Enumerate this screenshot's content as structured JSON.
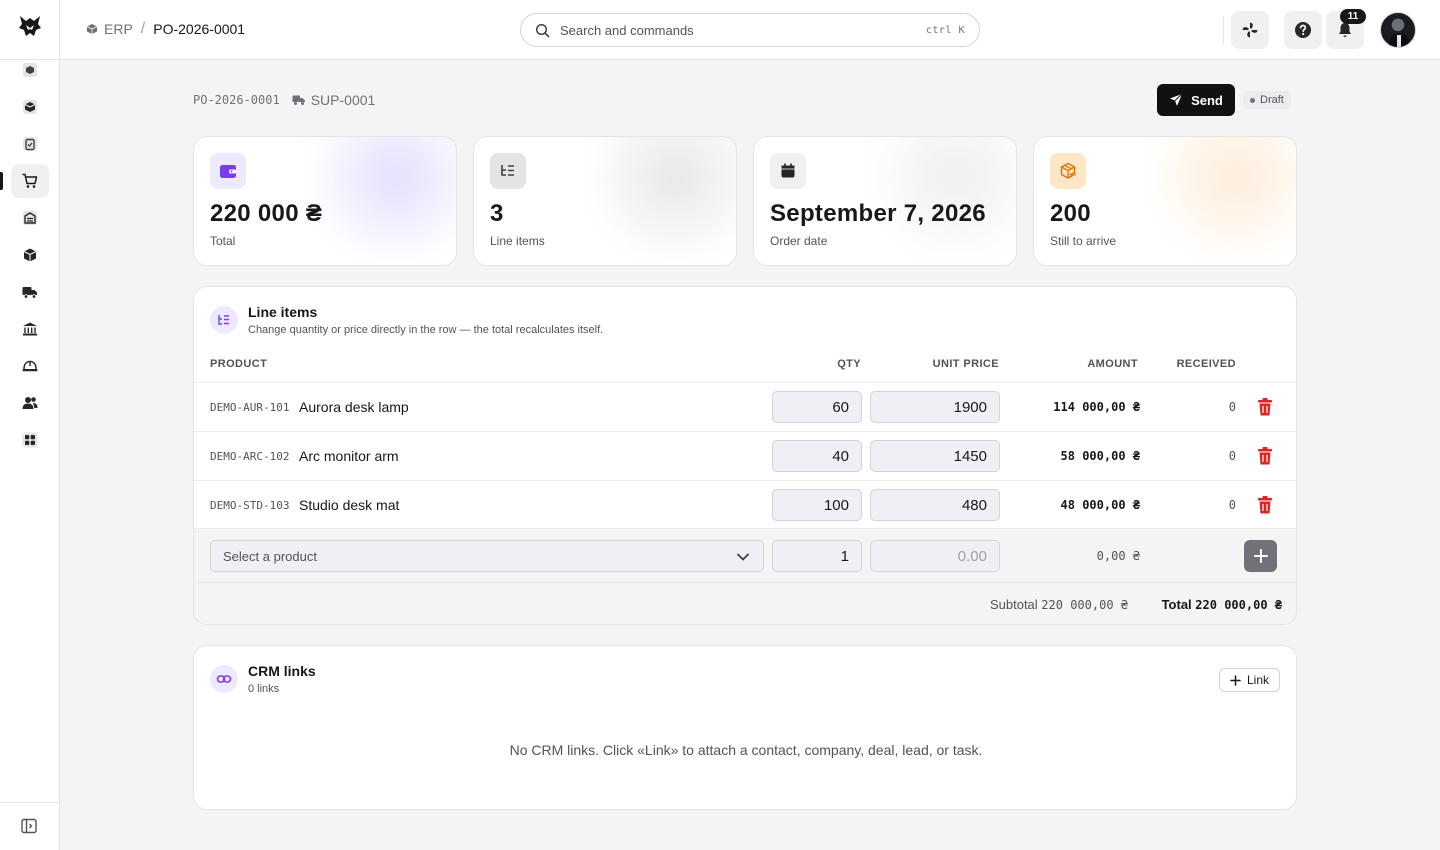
{
  "header": {
    "breadcrumb_root": "ERP",
    "breadcrumb_current": "PO-2026-0001",
    "search_placeholder": "Search and commands",
    "search_shortcut": "ctrl K",
    "notifications_count": "11"
  },
  "order": {
    "number": "PO-2026-0001",
    "supplier": "SUP-0001",
    "send_label": "Send",
    "status": "Draft"
  },
  "stats": [
    {
      "value": "220 000 ₴",
      "label": "Total",
      "icon": "wallet-icon",
      "accent": "#7c3aed"
    },
    {
      "value": "3",
      "label": "Line items",
      "icon": "list-icon",
      "accent": "#3f3f46"
    },
    {
      "value": "September 7, 2026",
      "label": "Order date",
      "icon": "calendar-icon",
      "accent": "#27272a"
    },
    {
      "value": "200",
      "label": "Still to arrive",
      "icon": "package-icon",
      "accent": "#d97706"
    }
  ],
  "line_items": {
    "title": "Line items",
    "subtitle": "Change quantity or price directly in the row — the total recalculates itself.",
    "columns": [
      "PRODUCT",
      "QTY",
      "UNIT PRICE",
      "AMOUNT",
      "RECEIVED"
    ],
    "rows": [
      {
        "sku": "DEMO-AUR-101",
        "name": "Aurora desk lamp",
        "qty": "60",
        "price": "1900",
        "amount": "114 000,00 ₴",
        "received": "0"
      },
      {
        "sku": "DEMO-ARC-102",
        "name": "Arc monitor arm",
        "qty": "40",
        "price": "1450",
        "amount": "58 000,00 ₴",
        "received": "0"
      },
      {
        "sku": "DEMO-STD-103",
        "name": "Studio desk mat",
        "qty": "100",
        "price": "480",
        "amount": "48 000,00 ₴",
        "received": "0"
      }
    ],
    "new_row": {
      "product_placeholder": "Select a product",
      "qty": "1",
      "price_placeholder": "0.00",
      "amount": "0,00 ₴"
    },
    "subtotal_label": "Subtotal",
    "subtotal_value": "220 000,00 ₴",
    "total_label": "Total",
    "total_value": "220 000,00 ₴"
  },
  "crm": {
    "title": "CRM links",
    "count": "0 links",
    "link_label": "Link",
    "empty": "No CRM links. Click «Link» to attach a contact, company, deal, lead, or task."
  },
  "colors": {
    "accent": "#7c3aed",
    "danger": "#dc2626",
    "primary_button": "#111114"
  }
}
